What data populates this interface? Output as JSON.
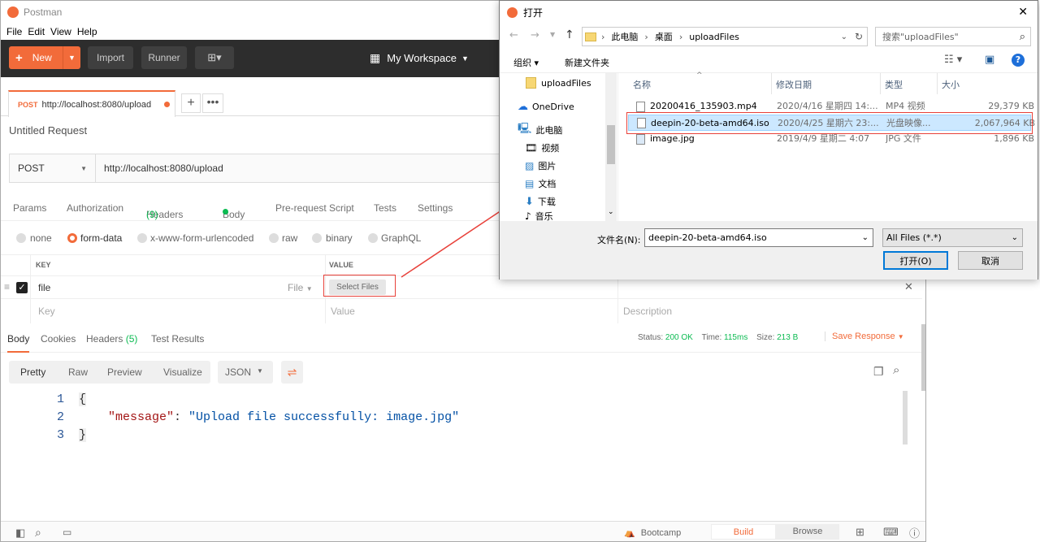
{
  "postman": {
    "app_title": "Postman",
    "menu": [
      "File",
      "Edit",
      "View",
      "Help"
    ],
    "toolbar": {
      "new_label": "New",
      "import_label": "Import",
      "runner_label": "Runner",
      "workspace_label": "My Workspace"
    },
    "request_tab": {
      "method": "POST",
      "url": "http://localhost:8080/upload"
    },
    "request_name": "Untitled Request",
    "method": "POST",
    "url": "http://localhost:8080/upload",
    "subtabs": {
      "params": "Params",
      "authorization": "Authorization",
      "headers": "Headers",
      "headers_count": "(9)",
      "body": "Body",
      "prerequest": "Pre-request Script",
      "tests": "Tests",
      "settings": "Settings"
    },
    "body_types": [
      "none",
      "form-data",
      "x-www-form-urlencoded",
      "raw",
      "binary",
      "GraphQL"
    ],
    "table": {
      "key_header": "KEY",
      "value_header": "VALUE",
      "row_key": "file",
      "row_type": "File",
      "select_files": "Select Files",
      "key_placeholder": "Key",
      "value_placeholder": "Value",
      "description_placeholder": "Description"
    },
    "response": {
      "tabs": {
        "body": "Body",
        "cookies": "Cookies",
        "headers": "Headers",
        "headers_count": "(5)",
        "test_results": "Test Results"
      },
      "status_label": "Status:",
      "status_value": "200 OK",
      "time_label": "Time:",
      "time_value": "115ms",
      "size_label": "Size:",
      "size_value": "213 B",
      "save_response": "Save Response",
      "view_modes": [
        "Pretty",
        "Raw",
        "Preview",
        "Visualize"
      ],
      "format": "JSON",
      "code_lines": [
        {
          "num": "1",
          "text": "{"
        },
        {
          "num": "2",
          "key": "\"message\"",
          "colon": ": ",
          "value": "\"Upload file successfully: image.jpg\""
        },
        {
          "num": "3",
          "text": "}"
        }
      ]
    },
    "statusbar": {
      "bootcamp": "Bootcamp",
      "build": "Build",
      "browse": "Browse"
    }
  },
  "dialog": {
    "title": "打开",
    "breadcrumb": [
      "此电脑",
      "桌面",
      "uploadFiles"
    ],
    "search_placeholder": "搜索\"uploadFiles\"",
    "organize": "组织 ▾",
    "new_folder": "新建文件夹",
    "nav_items": [
      "uploadFiles",
      "OneDrive",
      "此电脑",
      "视频",
      "图片",
      "文档",
      "下载",
      "音乐"
    ],
    "columns": {
      "name": "名称",
      "date": "修改日期",
      "type": "类型",
      "size": "大小"
    },
    "files": [
      {
        "name": "20200416_135903.mp4",
        "date": "2020/4/16 星期四 14:...",
        "type": "MP4 视频",
        "size": "29,379 KB"
      },
      {
        "name": "deepin-20-beta-amd64.iso",
        "date": "2020/4/25 星期六 23:...",
        "type": "光盘映像...",
        "size": "2,067,964 KB"
      },
      {
        "name": "image.jpg",
        "date": "2019/4/9 星期二 4:07",
        "type": "JPG 文件",
        "size": "1,896 KB"
      }
    ],
    "filename_label": "文件名(N):",
    "filename_value": "deepin-20-beta-amd64.iso",
    "filter_value": "All Files (*.*)",
    "open_button": "打开(O)",
    "cancel_button": "取消"
  },
  "colors": {
    "accent": "#f26b3a",
    "dialog_select": "#cce8ff",
    "annotation": "#e8413a"
  }
}
